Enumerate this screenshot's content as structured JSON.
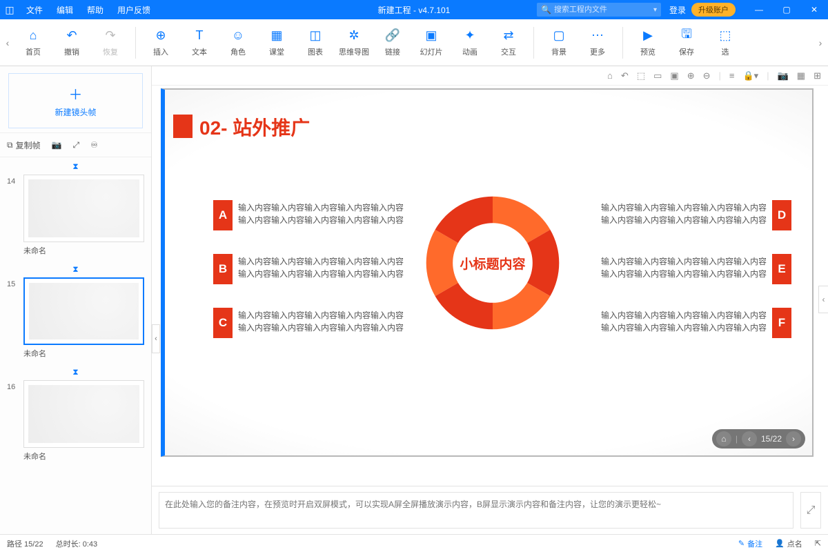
{
  "titlebar": {
    "menus": [
      "文件",
      "编辑",
      "帮助",
      "用户反馈"
    ],
    "title": "新建工程 - v4.7.101",
    "search_placeholder": "搜索工程内文件",
    "login": "登录",
    "upgrade": "升级账户"
  },
  "ribbon": {
    "tools": [
      {
        "icon": "⌂",
        "label": "首页"
      },
      {
        "icon": "↶",
        "label": "撤销"
      },
      {
        "icon": "↷",
        "label": "恢复",
        "dim": true
      },
      {
        "sep": true
      },
      {
        "icon": "⊕",
        "label": "插入"
      },
      {
        "icon": "T",
        "label": "文本"
      },
      {
        "icon": "☺",
        "label": "角色"
      },
      {
        "icon": "▦",
        "label": "课堂"
      },
      {
        "icon": "◫",
        "label": "图表"
      },
      {
        "icon": "✲",
        "label": "思维导图"
      },
      {
        "icon": "🔗",
        "label": "链接"
      },
      {
        "icon": "▣",
        "label": "幻灯片"
      },
      {
        "icon": "✦",
        "label": "动画"
      },
      {
        "icon": "⇄",
        "label": "交互"
      },
      {
        "sep": true
      },
      {
        "icon": "▢",
        "label": "背景"
      },
      {
        "icon": "⋯",
        "label": "更多"
      },
      {
        "sep": true
      },
      {
        "icon": "▶",
        "label": "预览"
      },
      {
        "icon": "🖫",
        "label": "保存"
      },
      {
        "icon": "⬚",
        "label": "选"
      }
    ]
  },
  "sidepanel": {
    "new_frame": "新建镜头帧",
    "copy_frame": "复制帧",
    "thumbs": [
      {
        "num": "14",
        "label": "未命名"
      },
      {
        "num": "15",
        "label": "未命名",
        "selected": true
      },
      {
        "num": "16",
        "label": "未命名"
      }
    ]
  },
  "slide": {
    "header": "02- 站外推广",
    "center": "小标题内容",
    "line": "输入内容输入内容输入内容输入内容输入内容",
    "tags_left": [
      "A",
      "B",
      "C"
    ],
    "tags_right": [
      "D",
      "E",
      "F"
    ],
    "counter": "15/22"
  },
  "notes": {
    "placeholder": "在此处输入您的备注内容，在预览时开启双屏模式，可以实现A屏全屏播放演示内容，B屏显示演示内容和备注内容，让您的演示更轻松~"
  },
  "status": {
    "path": "路径 15/22",
    "duration": "总时长: 0:43",
    "notes_btn": "备注",
    "click_btn": "点名"
  }
}
